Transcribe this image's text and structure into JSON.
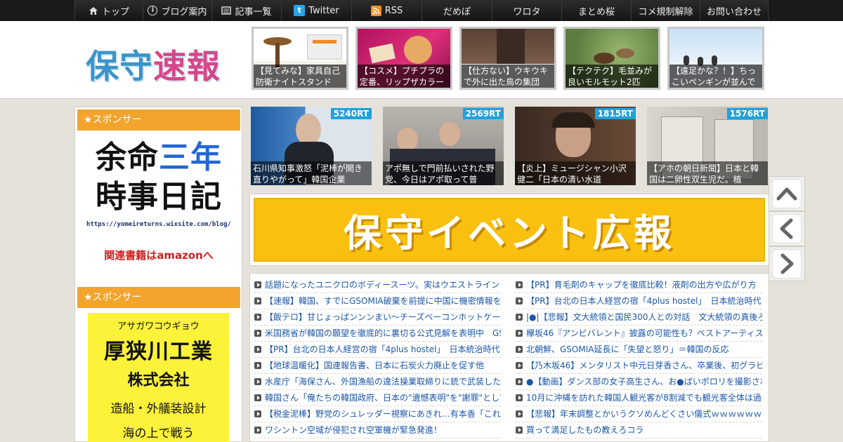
{
  "nav": {
    "items": [
      {
        "label": "トップ",
        "icon": "home-icon"
      },
      {
        "label": "ブログ案内",
        "icon": "info-icon"
      },
      {
        "label": "記事一覧",
        "icon": "list-icon"
      },
      {
        "label": "Twitter",
        "icon": "twitter-icon"
      },
      {
        "label": "RSS",
        "icon": "rss-icon"
      },
      {
        "label": "だめぽ",
        "icon": ""
      },
      {
        "label": "ワロタ",
        "icon": ""
      },
      {
        "label": "まとめ桜",
        "icon": ""
      },
      {
        "label": "コメ規制解除",
        "icon": ""
      },
      {
        "label": "お問い合わせ",
        "icon": ""
      }
    ]
  },
  "header": {
    "logo_text_a": "保守",
    "logo_text_b": "速報",
    "thumbs": [
      {
        "caption": "【見てみな】家具自己防衛ナイトスタンド"
      },
      {
        "caption": "【コスメ】プチプラの定番、リップザカラーの新色"
      },
      {
        "caption": "【仕方ない】ウキウキで外に出た鳥の集団"
      },
      {
        "caption": "【テクテク】毛並みが良いモルモット2匹"
      },
      {
        "caption": "【遠足かな？！】ちっこいペンギンが並んで"
      }
    ]
  },
  "sidebar": {
    "sponsor_title_1": "★スポンサー",
    "ad1": {
      "line1_a": "余命",
      "line1_b": "三年",
      "line2": "時事日記",
      "url": "https://yomeireturns.wixsite.com/blog/",
      "amazon": "関連書籍はamazonへ"
    },
    "sponsor_title_2": "★スポンサー",
    "ad2": {
      "kana": "アサガワコウギョウ",
      "name": "厚狭川工業",
      "corp": "株式会社",
      "desc": "造船・外艤装設計",
      "tail": "海の上で戦う"
    }
  },
  "rt_cards": [
    {
      "count": "5240RT",
      "caption": "石川県知事激怒「泥棒が開き直りやがって」韓国企業"
    },
    {
      "count": "2569RT",
      "caption": "アポ無しで門前払いされた野党、今日はアポ取って普"
    },
    {
      "count": "1815RT",
      "caption": "【炎上】ミュージシャン小沢健二「日本の清い水道"
    },
    {
      "count": "1576RT",
      "caption": "【アホの朝日新聞】日本と韓国は二卵性双生児だ。植"
    }
  ],
  "banner": {
    "text": "保守イベント広報"
  },
  "articles_left": [
    "話題になったユニクロのボディースーツ。実はウエストライン",
    "【速報】韓国、すでにGSOMIA破棄を前提に中国に機密情報を",
    "【飯テロ】甘じょっぱンンンまい〜チーズベーコンホットケー",
    "米国務省が韓国の願望を徹底的に裏切る公式見解を表明中　GS",
    "【PR】台北の日本人経営の宿「4plus hostel」　日本統治時代に",
    "【地球温暖化】国連報告書、日本に石炭火力廃止を促す他",
    "水産庁「海保さん、外国漁船の違法操業取締りに銃で武装した",
    "韓国さん「俺たちの韓国政府、日本の\"遺憾表明\"を\"謝罪\"として",
    "【税金泥棒】野党のシュレッダー視察にあきれ…有本香「これ",
    "ワシントン空域が侵犯され空軍機が緊急発進！"
  ],
  "articles_right": [
    "【PR】育毛剤のキャップを徹底比較！液剤の出方や広がり方",
    "【PR】台北の日本人経営の宿「4plus hostel」　日本統治時代に",
    "|●|【悲報】文大統領と国民300人との対話　文大統領の真後ろで",
    "欅坂46『アンビバレント』披露の可能性も？ベストアーティス",
    "北朝鮮、GSOMIA延長に「失望と怒り」＝韓国の反応",
    "【乃木坂46】メンタリスト中元日芽香さん、卒業後、初グラビ",
    "●【動画】ダンス部の女子高生さん、お●ぱいポロリを撮影され",
    "10月に沖縄を訪れた韓国人観光客が8割減でも観光客全体は過去",
    "【悲報】年末調整とかいうクソめんどくさい儀式ｗｗｗｗｗｗ",
    "買って満足したもの教えろコラ"
  ],
  "controls": [
    {
      "icon": "chevron-up-icon"
    },
    {
      "icon": "chevron-left-icon"
    },
    {
      "icon": "chevron-right-icon"
    }
  ]
}
